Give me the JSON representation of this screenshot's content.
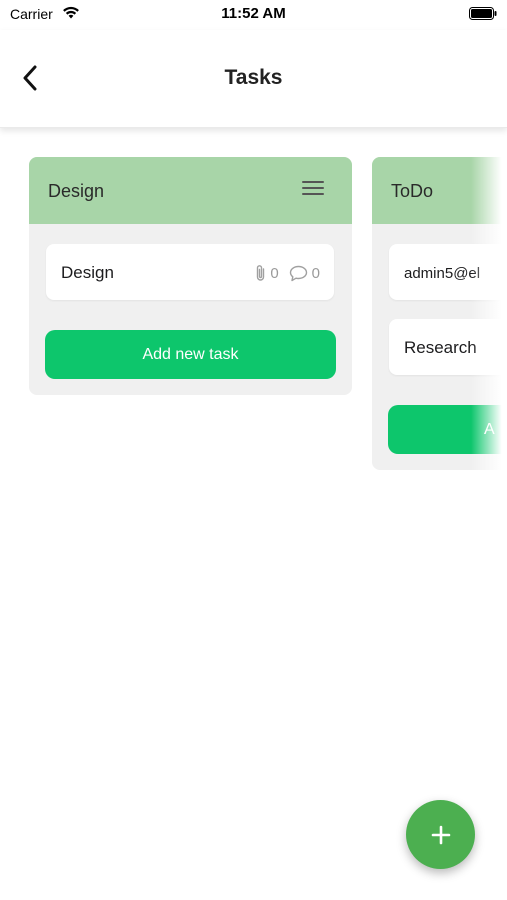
{
  "status_bar": {
    "carrier": "Carrier",
    "time": "11:52 AM",
    "wifi_icon": "wifi-icon",
    "battery_icon": "battery-icon"
  },
  "nav": {
    "title": "Tasks",
    "back_icon": "chevron-left-icon"
  },
  "columns": [
    {
      "title": "Design",
      "menu_icon": "hamburger-menu-icon",
      "tasks": [
        {
          "title": "Design",
          "attachments": "0",
          "comments": "0"
        }
      ],
      "add_label": "Add new task"
    },
    {
      "title": "ToDo",
      "tasks": [
        {
          "title": "admin5@el"
        },
        {
          "title": "Research"
        }
      ],
      "add_label": "A"
    }
  ],
  "fab": {
    "icon": "plus-icon"
  },
  "colors": {
    "column_header": "#a8d5a8",
    "column_bg": "#f0f0f0",
    "add_button": "#0dc66c",
    "fab": "#4caf50"
  }
}
